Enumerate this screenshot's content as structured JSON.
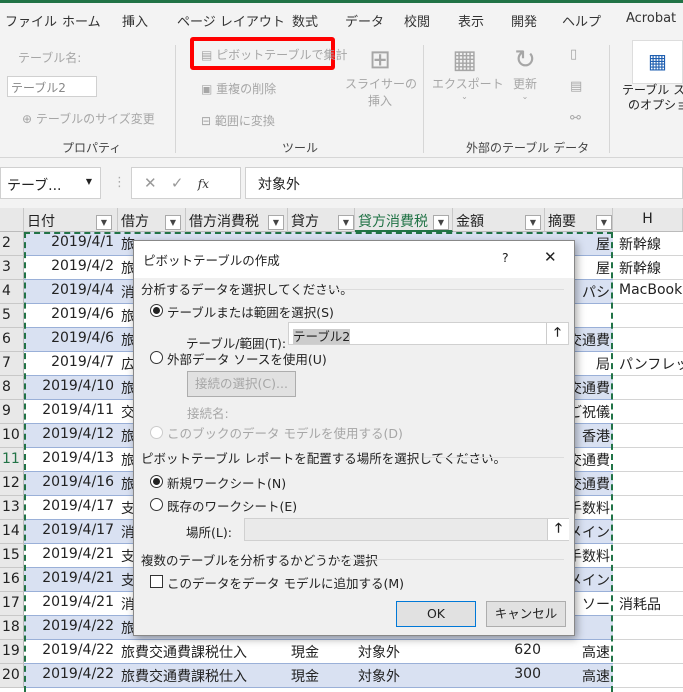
{
  "ribbon_tabs": [
    "ファイル",
    "ホーム",
    "挿入",
    "ページ レイアウト",
    "数式",
    "データ",
    "校閲",
    "表示",
    "開発",
    "ヘルプ",
    "Acrobat"
  ],
  "ribbon": {
    "table_name_label": "テーブル名:",
    "table_name_value": "テーブル2",
    "resize": "テーブルのサイズ変更",
    "group_properties": "プロパティ",
    "pivot": "ピボットテーブルで集計",
    "remove_dup": "重複の削除",
    "convert_range": "範囲に変換",
    "slicer1": "スライサーの",
    "slicer2": "挿入",
    "group_tools": "ツール",
    "export": "エクスポート",
    "refresh": "更新",
    "group_external": "外部のテーブル データ",
    "style_opt1": "テーブル スタ",
    "style_opt2": "のオプション",
    "highlight_color": "#ff0000"
  },
  "formula_bar": {
    "name_box": "テーブ...",
    "fx": "fx",
    "value": "対象外"
  },
  "columns": [
    "日付",
    "借方",
    "借方消費税",
    "貸方",
    "貸方消費税",
    "金額",
    "摘要",
    "H"
  ],
  "rows": [
    {
      "n": "2",
      "date": "2019/4/1",
      "b": "旅",
      "g": "屋",
      "h": "新幹線"
    },
    {
      "n": "3",
      "date": "2019/4/2",
      "b": "旅",
      "g": "屋",
      "h": "新幹線"
    },
    {
      "n": "4",
      "date": "2019/4/4",
      "b": "消",
      "g": "パシ",
      "h": "MacBook"
    },
    {
      "n": "5",
      "date": "2019/4/6",
      "b": "旅",
      "g": "",
      "h": ""
    },
    {
      "n": "6",
      "date": "2019/4/6",
      "b": "旅",
      "g": "a交通費",
      "h": ""
    },
    {
      "n": "7",
      "date": "2019/4/7",
      "b": "広",
      "g": "局",
      "h": "パンフレッ"
    },
    {
      "n": "8",
      "date": "2019/4/10",
      "b": "旅",
      "g": "a交通費",
      "h": ""
    },
    {
      "n": "9",
      "date": "2019/4/11",
      "b": "交",
      "g": "ご祝儀",
      "h": ""
    },
    {
      "n": "10",
      "date": "2019/4/12",
      "b": "旅",
      "g": "香港",
      "h": ""
    },
    {
      "n": "11",
      "date": "2019/4/13",
      "b": "旅",
      "g": "a交通費",
      "h": ""
    },
    {
      "n": "12",
      "date": "2019/4/16",
      "b": "旅",
      "g": "a交通費",
      "h": ""
    },
    {
      "n": "13",
      "date": "2019/4/17",
      "b": "支",
      "g": "手数料",
      "h": ""
    },
    {
      "n": "14",
      "date": "2019/4/17",
      "b": "消",
      "g": "く ドメイン",
      "h": ""
    },
    {
      "n": "15",
      "date": "2019/4/21",
      "b": "支",
      "g": "手数料",
      "h": ""
    },
    {
      "n": "16",
      "date": "2019/4/21",
      "b": "支",
      "g": "く ドメイン",
      "h": ""
    },
    {
      "n": "17",
      "date": "2019/4/21",
      "b": "消",
      "g": "ソー",
      "h": "消耗品"
    },
    {
      "n": "18",
      "date": "2019/4/22",
      "b": "旅",
      "g": "",
      "h": ""
    },
    {
      "n": "19",
      "date": "2019/4/22",
      "b": "旅費交通費課税仕入",
      "d": "現金",
      "e": "対象外",
      "f": "620",
      "g": "高速",
      "h": ""
    },
    {
      "n": "20",
      "date": "2019/4/22",
      "b": "旅費交通費課税仕入",
      "d": "現金",
      "e": "対象外",
      "f": "300",
      "g": "高速",
      "h": ""
    }
  ],
  "dialog": {
    "title": "ピボットテーブルの作成",
    "help": "?",
    "close": "✕",
    "section1": "分析するデータを選択してください。",
    "opt_table": "テーブルまたは範囲を選択(S)",
    "table_range_label": "テーブル/範囲(T):",
    "table_range_value": "テーブル2",
    "opt_external": "外部データ ソースを使用(U)",
    "choose_conn": "接続の選択(C)...",
    "conn_name": "接続名:",
    "opt_model": "このブックのデータ モデルを使用する(D)",
    "section2": "ピボットテーブル レポートを配置する場所を選択してください。",
    "opt_new": "新規ワークシート(N)",
    "opt_existing": "既存のワークシート(E)",
    "location_label": "場所(L):",
    "location_value": "",
    "section3": "複数のテーブルを分析するかどうかを選択",
    "add_model": "このデータをデータ モデルに追加する(M)",
    "add_model_checked": false,
    "ok": "OK",
    "cancel": "キャンセル"
  }
}
